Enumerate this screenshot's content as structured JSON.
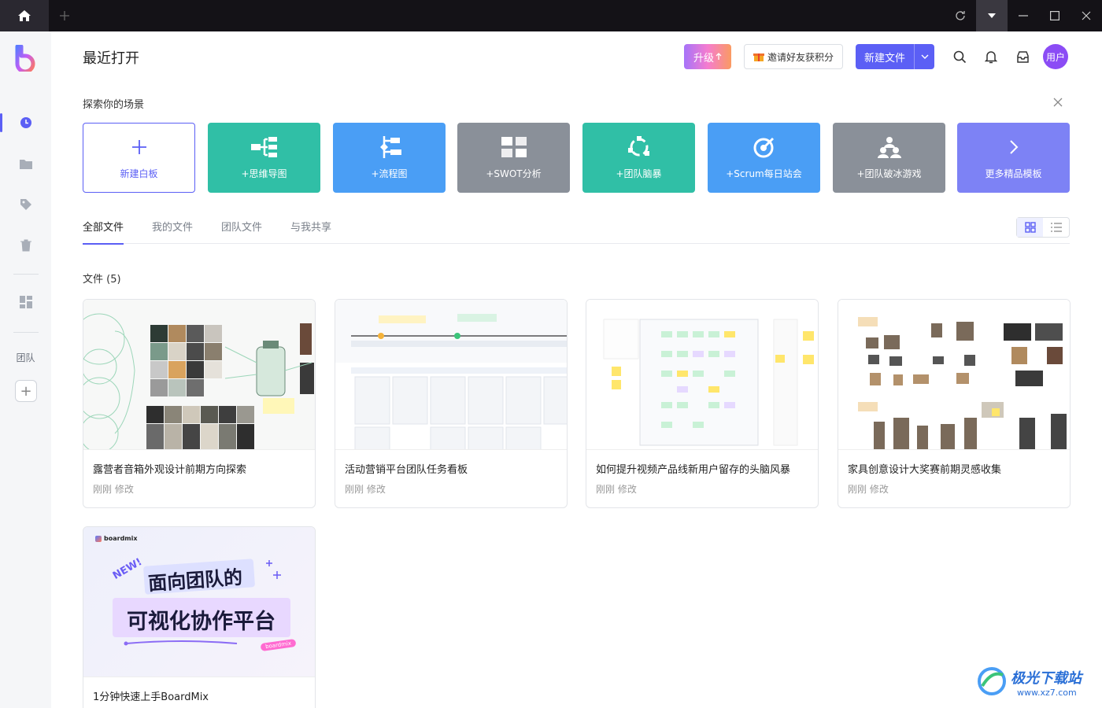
{
  "titlebar": {
    "home_icon": "home-icon",
    "new_tab_icon": "plus-icon",
    "controls": [
      "refresh-icon",
      "dropdown-icon",
      "minimize-icon",
      "maximize-icon",
      "close-icon"
    ]
  },
  "sidebar": {
    "items": [
      {
        "name": "recent",
        "icon": "clock-icon"
      },
      {
        "name": "folder",
        "icon": "folder-icon"
      },
      {
        "name": "tags",
        "icon": "tag-icon"
      },
      {
        "name": "trash",
        "icon": "trash-icon"
      },
      {
        "name": "templates",
        "icon": "dashboard-icon"
      }
    ],
    "team_label": "团队",
    "add_label": "+"
  },
  "header": {
    "title": "最近打开",
    "upgrade_label": "升级",
    "invite_label": "邀请好友获积分",
    "new_file_label": "新建文件",
    "avatar_label": "用户"
  },
  "explore": {
    "title": "探索你的场景",
    "templates": [
      {
        "label": "新建白板",
        "color": "#ffffff"
      },
      {
        "label": "+思维导图",
        "color": "#30bfa6"
      },
      {
        "label": "+流程图",
        "color": "#4a9ef5"
      },
      {
        "label": "+SWOT分析",
        "color": "#8a9099"
      },
      {
        "label": "+团队脑暴",
        "color": "#30bfa6"
      },
      {
        "label": "+Scrum每日站会",
        "color": "#4a9ef5"
      },
      {
        "label": "+团队破冰游戏",
        "color": "#8a9099"
      },
      {
        "label": "更多精品模板",
        "color": "#7d82f5"
      }
    ]
  },
  "tabs": [
    {
      "label": "全部文件",
      "active": true
    },
    {
      "label": "我的文件",
      "active": false
    },
    {
      "label": "团队文件",
      "active": false
    },
    {
      "label": "与我共享",
      "active": false
    }
  ],
  "files": {
    "count_label": "文件 (5)",
    "items": [
      {
        "name": "露营者音箱外观设计前期方向探索",
        "meta": "刚刚 修改"
      },
      {
        "name": "活动营销平台团队任务看板",
        "meta": "刚刚 修改"
      },
      {
        "name": "如何提升视频产品线新用户留存的头脑风暴",
        "meta": "刚刚 修改"
      },
      {
        "name": "家具创意设计大奖赛前期灵感收集",
        "meta": "刚刚 修改"
      },
      {
        "name": "1分钟快速上手BoardMix",
        "meta": ""
      }
    ]
  },
  "promo": {
    "brand": "boardmix",
    "new_badge": "NEW!",
    "line1": "面向团队的",
    "line2": "可视化协作平台",
    "tag": "boardmix"
  },
  "watermark": {
    "text": "极光下载站",
    "url": "www.xz7.com"
  },
  "colors": {
    "accent": "#5b5ff5",
    "titlebar": "#141217",
    "sidebar": "#f5f6f8"
  }
}
